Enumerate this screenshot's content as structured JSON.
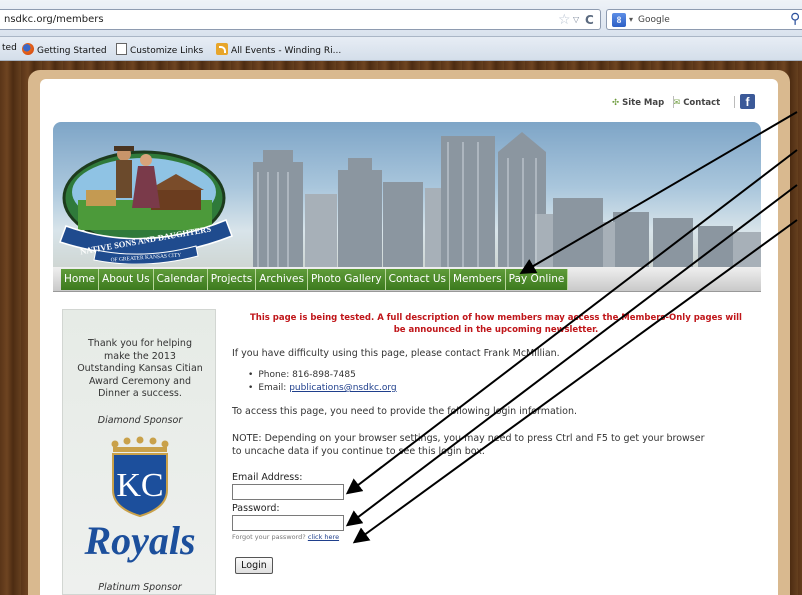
{
  "browser": {
    "url": "nsdkc.org/members",
    "search_engine_letter": "8",
    "search_placeholder": "Google",
    "bookmarks": [
      "ted",
      "Getting Started",
      "Customize Links",
      "All Events - Winding Ri..."
    ]
  },
  "header": {
    "site_map": "Site Map",
    "contact": "Contact",
    "facebook_letter": "f",
    "logo_line1": "NATIVE SONS AND DAUGHTERS",
    "logo_line2": "OF GREATER KANSAS CITY"
  },
  "nav": {
    "items": [
      "Home",
      "About Us",
      "Calendar",
      "Projects",
      "Archives",
      "Photo Gallery",
      "Contact Us",
      "Members",
      "Pay Online"
    ]
  },
  "sidebar": {
    "thanks": [
      "Thank you for helping",
      "make the 2013",
      "Outstanding Kansas Citian",
      "Award Ceremony and",
      "Dinner a success."
    ],
    "diamond_sponsor": "Diamond Sponsor",
    "royals_kc": "KC",
    "royals_word": "Royals",
    "platinum_sponsor": "Platinum Sponsor"
  },
  "main": {
    "notice_line1": "This page is being tested.  A full description of how members may access the Members-Only pages will",
    "notice_line2": "be announced in the upcoming newsletter.",
    "difficulty": "If you have difficulty using this page, please contact Frank McMillian.",
    "phone": "Phone:  816-898-7485",
    "email_label": "Email: ",
    "email_link": "publications@nsdkc.org",
    "access": "To access this page, you need to provide the following login information.",
    "note_line1": "NOTE: Depending on your browser settings, you may need to press Ctrl and F5 to get your browser",
    "note_line2": "to uncache data if you continue to see this login box.",
    "email_field_label": "Email Address:",
    "password_field_label": "Password:",
    "forgot_text": "Forgot your password? ",
    "forgot_link": "click here",
    "login_button": "Login"
  },
  "colors": {
    "nav_green": "#4a8a2a",
    "notice_red": "#c0161a",
    "wood": "#5a3518",
    "link_blue": "#1f3f8c"
  }
}
